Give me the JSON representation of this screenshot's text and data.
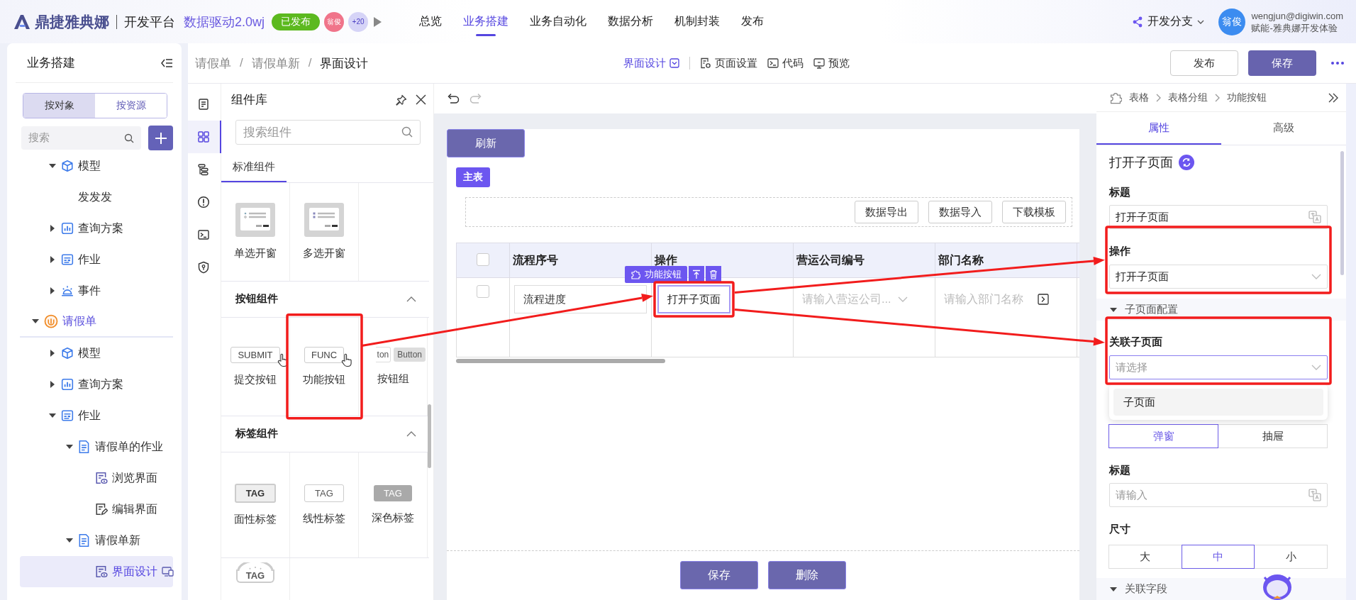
{
  "topbar": {
    "logo": "鼎捷雅典娜",
    "platform": "开发平台",
    "app_name": "数据驱动2.0wj",
    "status": "已发布",
    "avatars": [
      "翁俊",
      "+20"
    ],
    "nav": [
      {
        "label": "总览",
        "selected": false
      },
      {
        "label": "业务搭建",
        "selected": true
      },
      {
        "label": "业务自动化",
        "selected": false
      },
      {
        "label": "数据分析",
        "selected": false
      },
      {
        "label": "机制封装",
        "selected": false
      },
      {
        "label": "发布",
        "selected": false
      }
    ],
    "branch": "开发分支",
    "user": {
      "avatar": "翁俊",
      "email": "wengjun@digiwin.com",
      "org": "赋能-雅典娜开发体验"
    }
  },
  "sidebar": {
    "title": "业务搭建",
    "modes": [
      {
        "label": "按对象",
        "selected": true
      },
      {
        "label": "按资源",
        "selected": false
      }
    ],
    "search": {
      "placeholder": "搜索"
    },
    "tree_partial": [
      {
        "label": "模型",
        "kind": "cube",
        "expanded": true,
        "selected": false,
        "children": [
          {
            "label": "发发发",
            "selected": false
          }
        ]
      },
      {
        "label": "查询方案",
        "kind": "chart",
        "expanded": false,
        "selected": false
      },
      {
        "label": "作业",
        "kind": "form",
        "expanded": false,
        "selected": false
      },
      {
        "label": "事件",
        "kind": "event",
        "expanded": false,
        "selected": false
      }
    ],
    "tree": [
      {
        "label": "请假单",
        "kind": "app",
        "expanded": true,
        "selected": false,
        "children": [
          {
            "label": "模型",
            "kind": "cube",
            "expanded": false,
            "selected": false
          },
          {
            "label": "查询方案",
            "kind": "chart",
            "expanded": false,
            "selected": false
          },
          {
            "label": "作业",
            "kind": "form",
            "expanded": true,
            "selected": false,
            "children": [
              {
                "label": "请假单的作业",
                "kind": "page",
                "expanded": true,
                "selected": false,
                "children": [
                  {
                    "label": "浏览界面",
                    "kind": "view",
                    "selected": false
                  },
                  {
                    "label": "编辑界面",
                    "kind": "edit",
                    "selected": false
                  }
                ]
              },
              {
                "label": "请假单新",
                "kind": "page",
                "expanded": true,
                "selected": false,
                "children": [
                  {
                    "label": "界面设计",
                    "kind": "view",
                    "selected": true
                  }
                ]
              }
            ]
          }
        ]
      }
    ]
  },
  "header": {
    "breadcrumb": [
      "请假单",
      "请假单新",
      "界面设计"
    ],
    "separator": "/",
    "tools": [
      {
        "label": "界面设计",
        "kind": "dropdown"
      },
      {
        "label": "页面设置",
        "kind": "settings"
      },
      {
        "label": "代码",
        "kind": "code"
      },
      {
        "label": "预览",
        "kind": "preview"
      }
    ],
    "publish": "发布",
    "save": "保存"
  },
  "rail": [
    {
      "kind": "form",
      "selected": false
    },
    {
      "kind": "grid",
      "selected": true
    },
    {
      "kind": "tree",
      "selected": false
    },
    {
      "kind": "alert",
      "selected": false
    },
    {
      "kind": "terminal",
      "selected": false
    },
    {
      "kind": "shield",
      "selected": false
    }
  ],
  "library": {
    "title": "组件库",
    "search": {
      "placeholder": "搜索组件"
    },
    "tabs": [
      {
        "label": "标准组件",
        "selected": true
      }
    ],
    "groups": [
      {
        "items": [
          {
            "label": "单选开窗",
            "kind": "dialog-single"
          },
          {
            "label": "多选开窗",
            "kind": "dialog-multi"
          }
        ]
      },
      {
        "title": "按钮组件",
        "expanded": true,
        "items": [
          {
            "label": "提交按钮",
            "kind": "button",
            "preview_text": "SUBMIT"
          },
          {
            "label": "功能按钮",
            "kind": "button",
            "preview_text": "FUNC",
            "highlighted": true
          },
          {
            "label": "按钮组",
            "kind": "button-group",
            "preview_texts": [
              "ton",
              "Button"
            ]
          }
        ]
      },
      {
        "title": "标签组件",
        "expanded": true,
        "items": [
          {
            "label": "面性标签",
            "kind": "tag-filled",
            "preview_text": "TAG"
          },
          {
            "label": "线性标签",
            "kind": "tag-outline",
            "preview_text": "TAG"
          },
          {
            "label": "深色标签",
            "kind": "tag-dark",
            "preview_text": "TAG"
          }
        ]
      },
      {
        "items": [
          {
            "kind": "tag-badge",
            "preview_text": "TAG"
          }
        ]
      }
    ]
  },
  "canvas": {
    "refresh": "刷新",
    "table_tag": "主表",
    "table_actions": [
      "数据导出",
      "数据导入",
      "下载模板"
    ],
    "header_checked": false,
    "columns": [
      "流程序号",
      "操作",
      "营运公司编号",
      "部门名称"
    ],
    "row": {
      "checked": false,
      "cells": [
        {
          "kind": "input",
          "value": "流程进度"
        },
        {
          "kind": "button",
          "label": "打开子页面",
          "selected": true,
          "highlighted": true
        },
        {
          "kind": "select",
          "placeholder": "请输入营运公司..."
        },
        {
          "kind": "input",
          "placeholder": "请输入部门名称"
        }
      ]
    },
    "selection_toolbar": "功能按钮",
    "footer_buttons": [
      "保存",
      "删除"
    ]
  },
  "inspector": {
    "breadcrumb": [
      "表格",
      "表格分组",
      "功能按钮"
    ],
    "tabs": [
      {
        "label": "属性",
        "selected": true
      },
      {
        "label": "高级",
        "selected": false
      }
    ],
    "heading": "打开子页面",
    "fields": [
      {
        "kind": "text",
        "label": "标题",
        "value": "打开子页面"
      },
      {
        "kind": "select",
        "label": "操作",
        "value": "打开子页面",
        "highlighted": true
      },
      {
        "kind": "section",
        "label": "子页面配置",
        "expanded": true
      },
      {
        "kind": "select",
        "label": "关联子页面",
        "placeholder": "请选择",
        "focused": true,
        "highlighted": true,
        "options": [
          "子页面"
        ]
      },
      {
        "kind": "segmented",
        "options": [
          {
            "label": "弹窗",
            "selected": true
          },
          {
            "label": "抽屉",
            "selected": false
          }
        ]
      },
      {
        "kind": "text",
        "label": "标题",
        "placeholder": "请输入"
      },
      {
        "kind": "segmented",
        "label": "尺寸",
        "options": [
          {
            "label": "大",
            "selected": false
          },
          {
            "label": "中",
            "selected": true
          },
          {
            "label": "小",
            "selected": false
          }
        ]
      },
      {
        "kind": "section",
        "label": "关联字段",
        "expanded": true
      }
    ]
  }
}
